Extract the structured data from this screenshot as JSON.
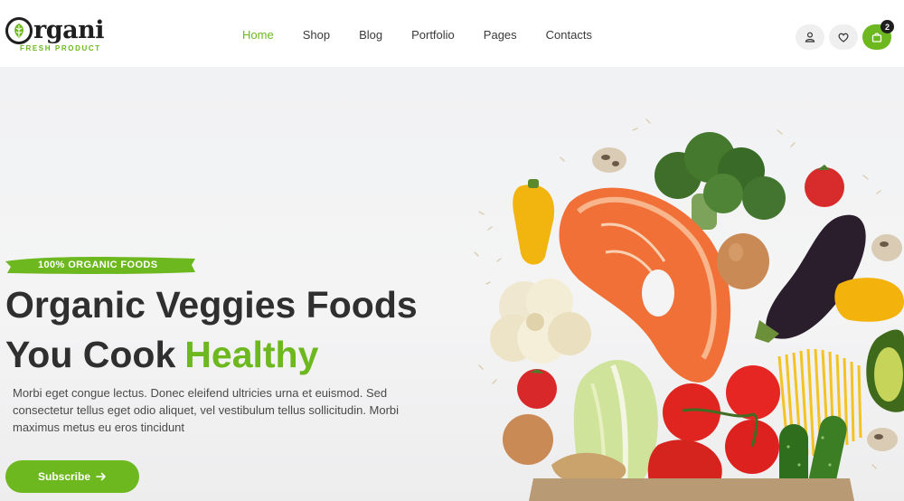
{
  "brand": {
    "logo_text": "rgani",
    "tagline": "FRESH PRODUCT",
    "accent_color": "#6cb81e"
  },
  "nav": {
    "items": [
      {
        "label": "Home",
        "active": true
      },
      {
        "label": "Shop",
        "active": false
      },
      {
        "label": "Blog",
        "active": false
      },
      {
        "label": "Portfolio",
        "active": false
      },
      {
        "label": "Pages",
        "active": false
      },
      {
        "label": "Contacts",
        "active": false
      }
    ]
  },
  "header_icons": {
    "account": "user-icon",
    "wishlist": "heart-icon",
    "cart": "shopping-bag-icon",
    "cart_count": "2"
  },
  "hero": {
    "tag": "100% ORGANIC FOODS",
    "headline_line1": "Organic Veggies Foods",
    "headline_line2_prefix": "You Cook",
    "headline_line2_accent": "Healthy",
    "description": "Morbi eget congue lectus. Donec eleifend ultricies urna et euismod. Sed consectetur tellus eget odio aliquet, vel vestibulum tellus sollicitudin. Morbi maximus metus eu eros tincidunt",
    "cta_label": "Subscribe",
    "cta_icon": "arrow-right-icon"
  }
}
